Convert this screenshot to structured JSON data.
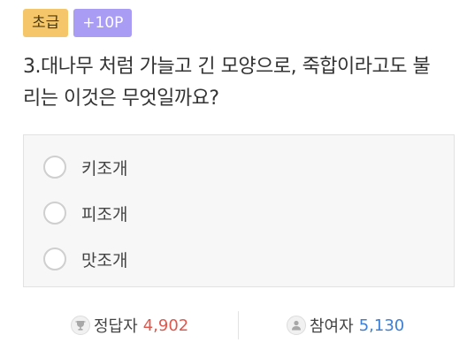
{
  "badges": {
    "level": "초급",
    "points": "+10P"
  },
  "question": {
    "text": "3.대나무 처럼 가늘고 긴 모양으로, 죽합이라고도 불리는 이것은 무엇일까요?"
  },
  "options": [
    {
      "label": "키조개"
    },
    {
      "label": "피조개"
    },
    {
      "label": "맛조개"
    }
  ],
  "stats": {
    "correct_label": "정답자",
    "correct_value": "4,902",
    "participants_label": "참여자",
    "participants_value": "5,130",
    "correct_icon": "trophy-icon",
    "participants_icon": "person-icon",
    "correct_color": "#e2574c",
    "participants_color": "#3d7fd6"
  },
  "colors": {
    "level_badge": "#f5c76a",
    "points_badge": "#a99cf5"
  }
}
